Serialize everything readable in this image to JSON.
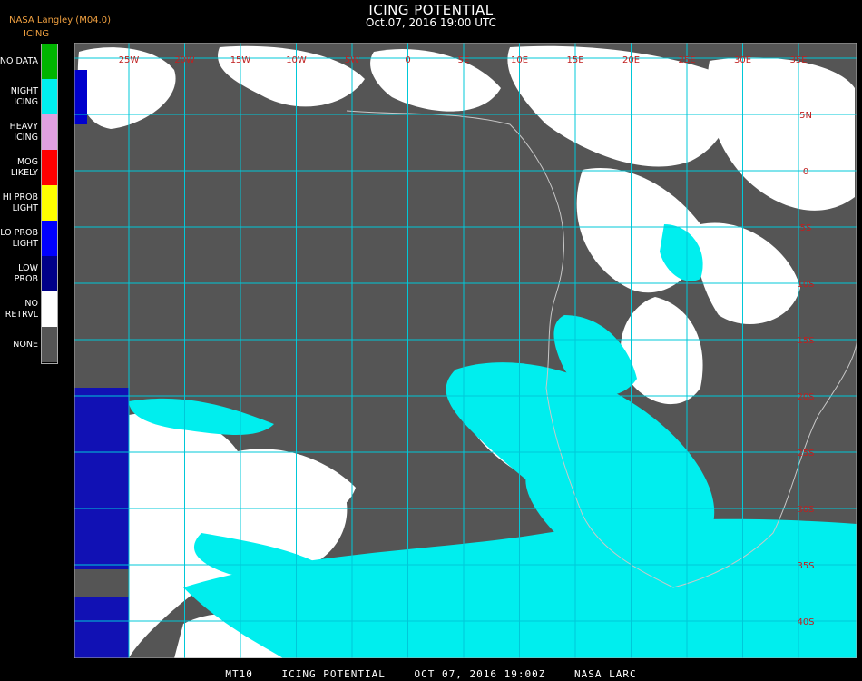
{
  "header": {
    "title": "ICING POTENTIAL",
    "subtitle": "Oct.07, 2016 19:00 UTC",
    "brand": "NASA Langley (M04.0)",
    "legend_title": "ICING"
  },
  "legend": {
    "items": [
      {
        "lines": [
          "NO DATA"
        ],
        "color": "#00b400"
      },
      {
        "lines": [
          "NIGHT",
          "ICING"
        ],
        "color": "#00eeee"
      },
      {
        "lines": [
          "HEAVY",
          "ICING"
        ],
        "color": "#e0a0e0"
      },
      {
        "lines": [
          "MOG",
          "LIKELY"
        ],
        "color": "#ff0000"
      },
      {
        "lines": [
          "HI PROB",
          "LIGHT"
        ],
        "color": "#ffff00"
      },
      {
        "lines": [
          "LO PROB",
          "LIGHT"
        ],
        "color": "#0000ff"
      },
      {
        "lines": [
          "LOW",
          "PROB"
        ],
        "color": "#000088"
      },
      {
        "lines": [
          "NO",
          "RETRVL"
        ],
        "color": "#ffffff"
      },
      {
        "lines": [
          "NONE"
        ],
        "color": "#555555"
      }
    ]
  },
  "map": {
    "background": "#555555",
    "grid_color": "#00c8d8",
    "label_color": "#c02020",
    "lon_labels": [
      "25W",
      "20W",
      "15W",
      "10W",
      "5W",
      "0",
      "5E",
      "10E",
      "15E",
      "20E",
      "25E",
      "30E",
      "35E"
    ],
    "lat_labels": [
      "10N",
      "5N",
      "0",
      "5S",
      "10S",
      "15S",
      "20S",
      "25S",
      "30S",
      "35S",
      "40S"
    ]
  },
  "footer": {
    "sat": "MT10",
    "product": "ICING POTENTIAL",
    "datetime": "OCT 07, 2016 19:00Z",
    "agency": "NASA LARC"
  }
}
